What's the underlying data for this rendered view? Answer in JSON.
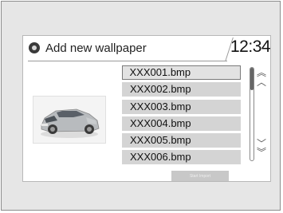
{
  "header": {
    "icon": "settings-gear-icon",
    "title": "Add new wallpaper",
    "clock": "12:34"
  },
  "preview": {
    "image": "car-thumbnail",
    "color": "#b5b8bb"
  },
  "files": {
    "items": [
      {
        "label": "XXX001.bmp",
        "selected": true
      },
      {
        "label": "XXX002.bmp",
        "selected": false
      },
      {
        "label": "XXX003.bmp",
        "selected": false
      },
      {
        "label": "XXX004.bmp",
        "selected": false
      },
      {
        "label": "XXX005.bmp",
        "selected": false
      },
      {
        "label": "XXX006.bmp",
        "selected": false
      }
    ]
  },
  "scroll": {
    "up_icons": [
      "double-chevron-up-icon",
      "chevron-up-icon"
    ],
    "down_icons": [
      "chevron-down-icon",
      "double-chevron-down-icon"
    ],
    "position": 0
  },
  "action": {
    "label": "Start Import"
  }
}
